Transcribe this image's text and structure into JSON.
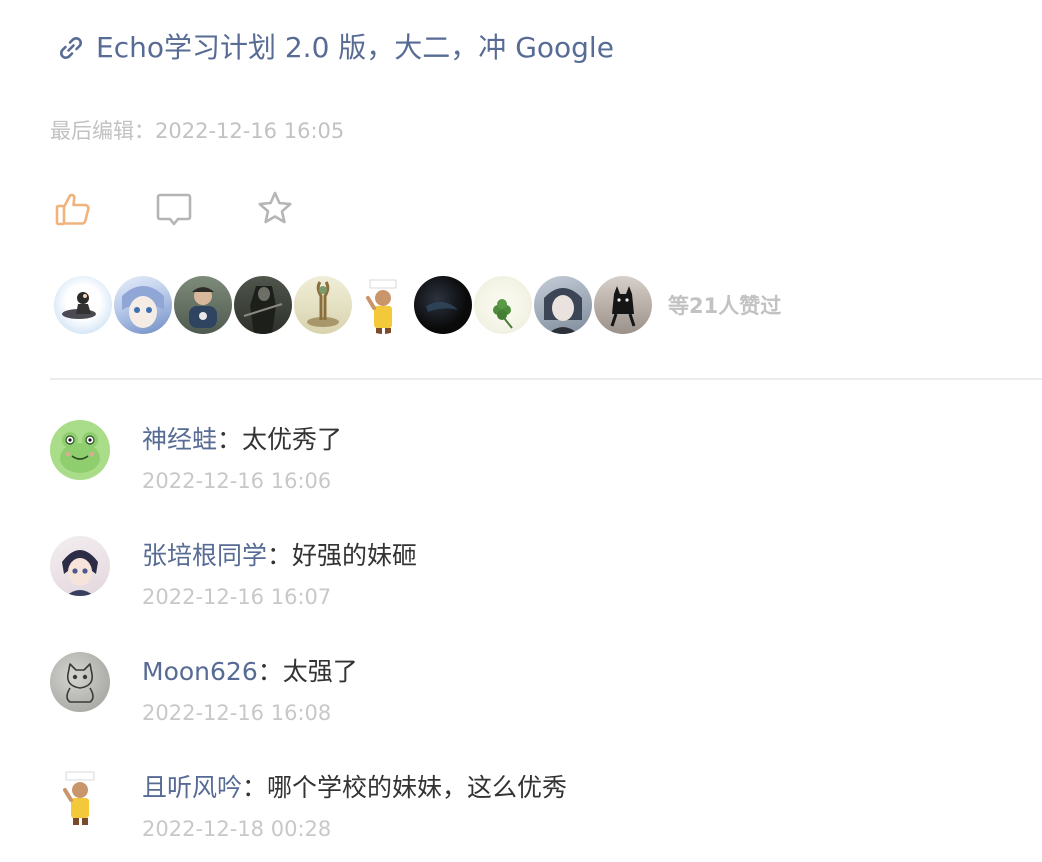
{
  "post": {
    "link_title": "Echo学习计划 2.0 版，大二，冲 Google",
    "link_icon": "link-icon",
    "last_edit_label": "最后编辑：",
    "last_edit_time": "2022-12-16 16:05"
  },
  "actions": {
    "like_icon": "thumbs-up-icon",
    "comment_icon": "comment-icon",
    "favorite_icon": "star-icon",
    "like_color": "#f0b37c",
    "icon_color": "#b5b5b5"
  },
  "likes": {
    "count_text": "等21人赞过",
    "avatars": [
      {
        "name": "liker-avatar-1",
        "palette": [
          "#e8f2fb",
          "#2b3a55"
        ]
      },
      {
        "name": "liker-avatar-2",
        "palette": [
          "#d7e4f5",
          "#8aa8d8"
        ]
      },
      {
        "name": "liker-avatar-3",
        "palette": [
          "#5b6b5e",
          "#c8b8a2"
        ]
      },
      {
        "name": "liker-avatar-4",
        "palette": [
          "#3c4138",
          "#8a8a80"
        ]
      },
      {
        "name": "liker-avatar-5",
        "palette": [
          "#e8e6c9",
          "#9a8a5f"
        ]
      },
      {
        "name": "liker-avatar-6",
        "palette": [
          "#ffffff",
          "#e0b93a"
        ]
      },
      {
        "name": "liker-avatar-7",
        "palette": [
          "#0b0b0b",
          "#3a4a5c"
        ]
      },
      {
        "name": "liker-avatar-8",
        "palette": [
          "#f4f4ea",
          "#4c8a3a"
        ]
      },
      {
        "name": "liker-avatar-9",
        "palette": [
          "#9aa7b6",
          "#2f3847"
        ]
      },
      {
        "name": "liker-avatar-10",
        "palette": [
          "#b8aea8",
          "#1c1c1c"
        ]
      }
    ]
  },
  "comments": [
    {
      "author": "神经蛙",
      "sep": "：",
      "text": "太优秀了",
      "time": "2022-12-16 16:06",
      "avatar": "frog-avatar"
    },
    {
      "author": "张培根同学",
      "sep": "：",
      "text": "好强的妹砸",
      "time": "2022-12-16 16:07",
      "avatar": "anime-boy-avatar"
    },
    {
      "author": "Moon626",
      "sep": "：",
      "text": "太强了",
      "time": "2022-12-16 16:08",
      "avatar": "cat-sketch-avatar"
    },
    {
      "author": "且听风吟",
      "sep": "：",
      "text": "哪个学校的妹妹，这么优秀",
      "time": "2022-12-18 00:28",
      "avatar": "cartoon-player-avatar"
    }
  ]
}
